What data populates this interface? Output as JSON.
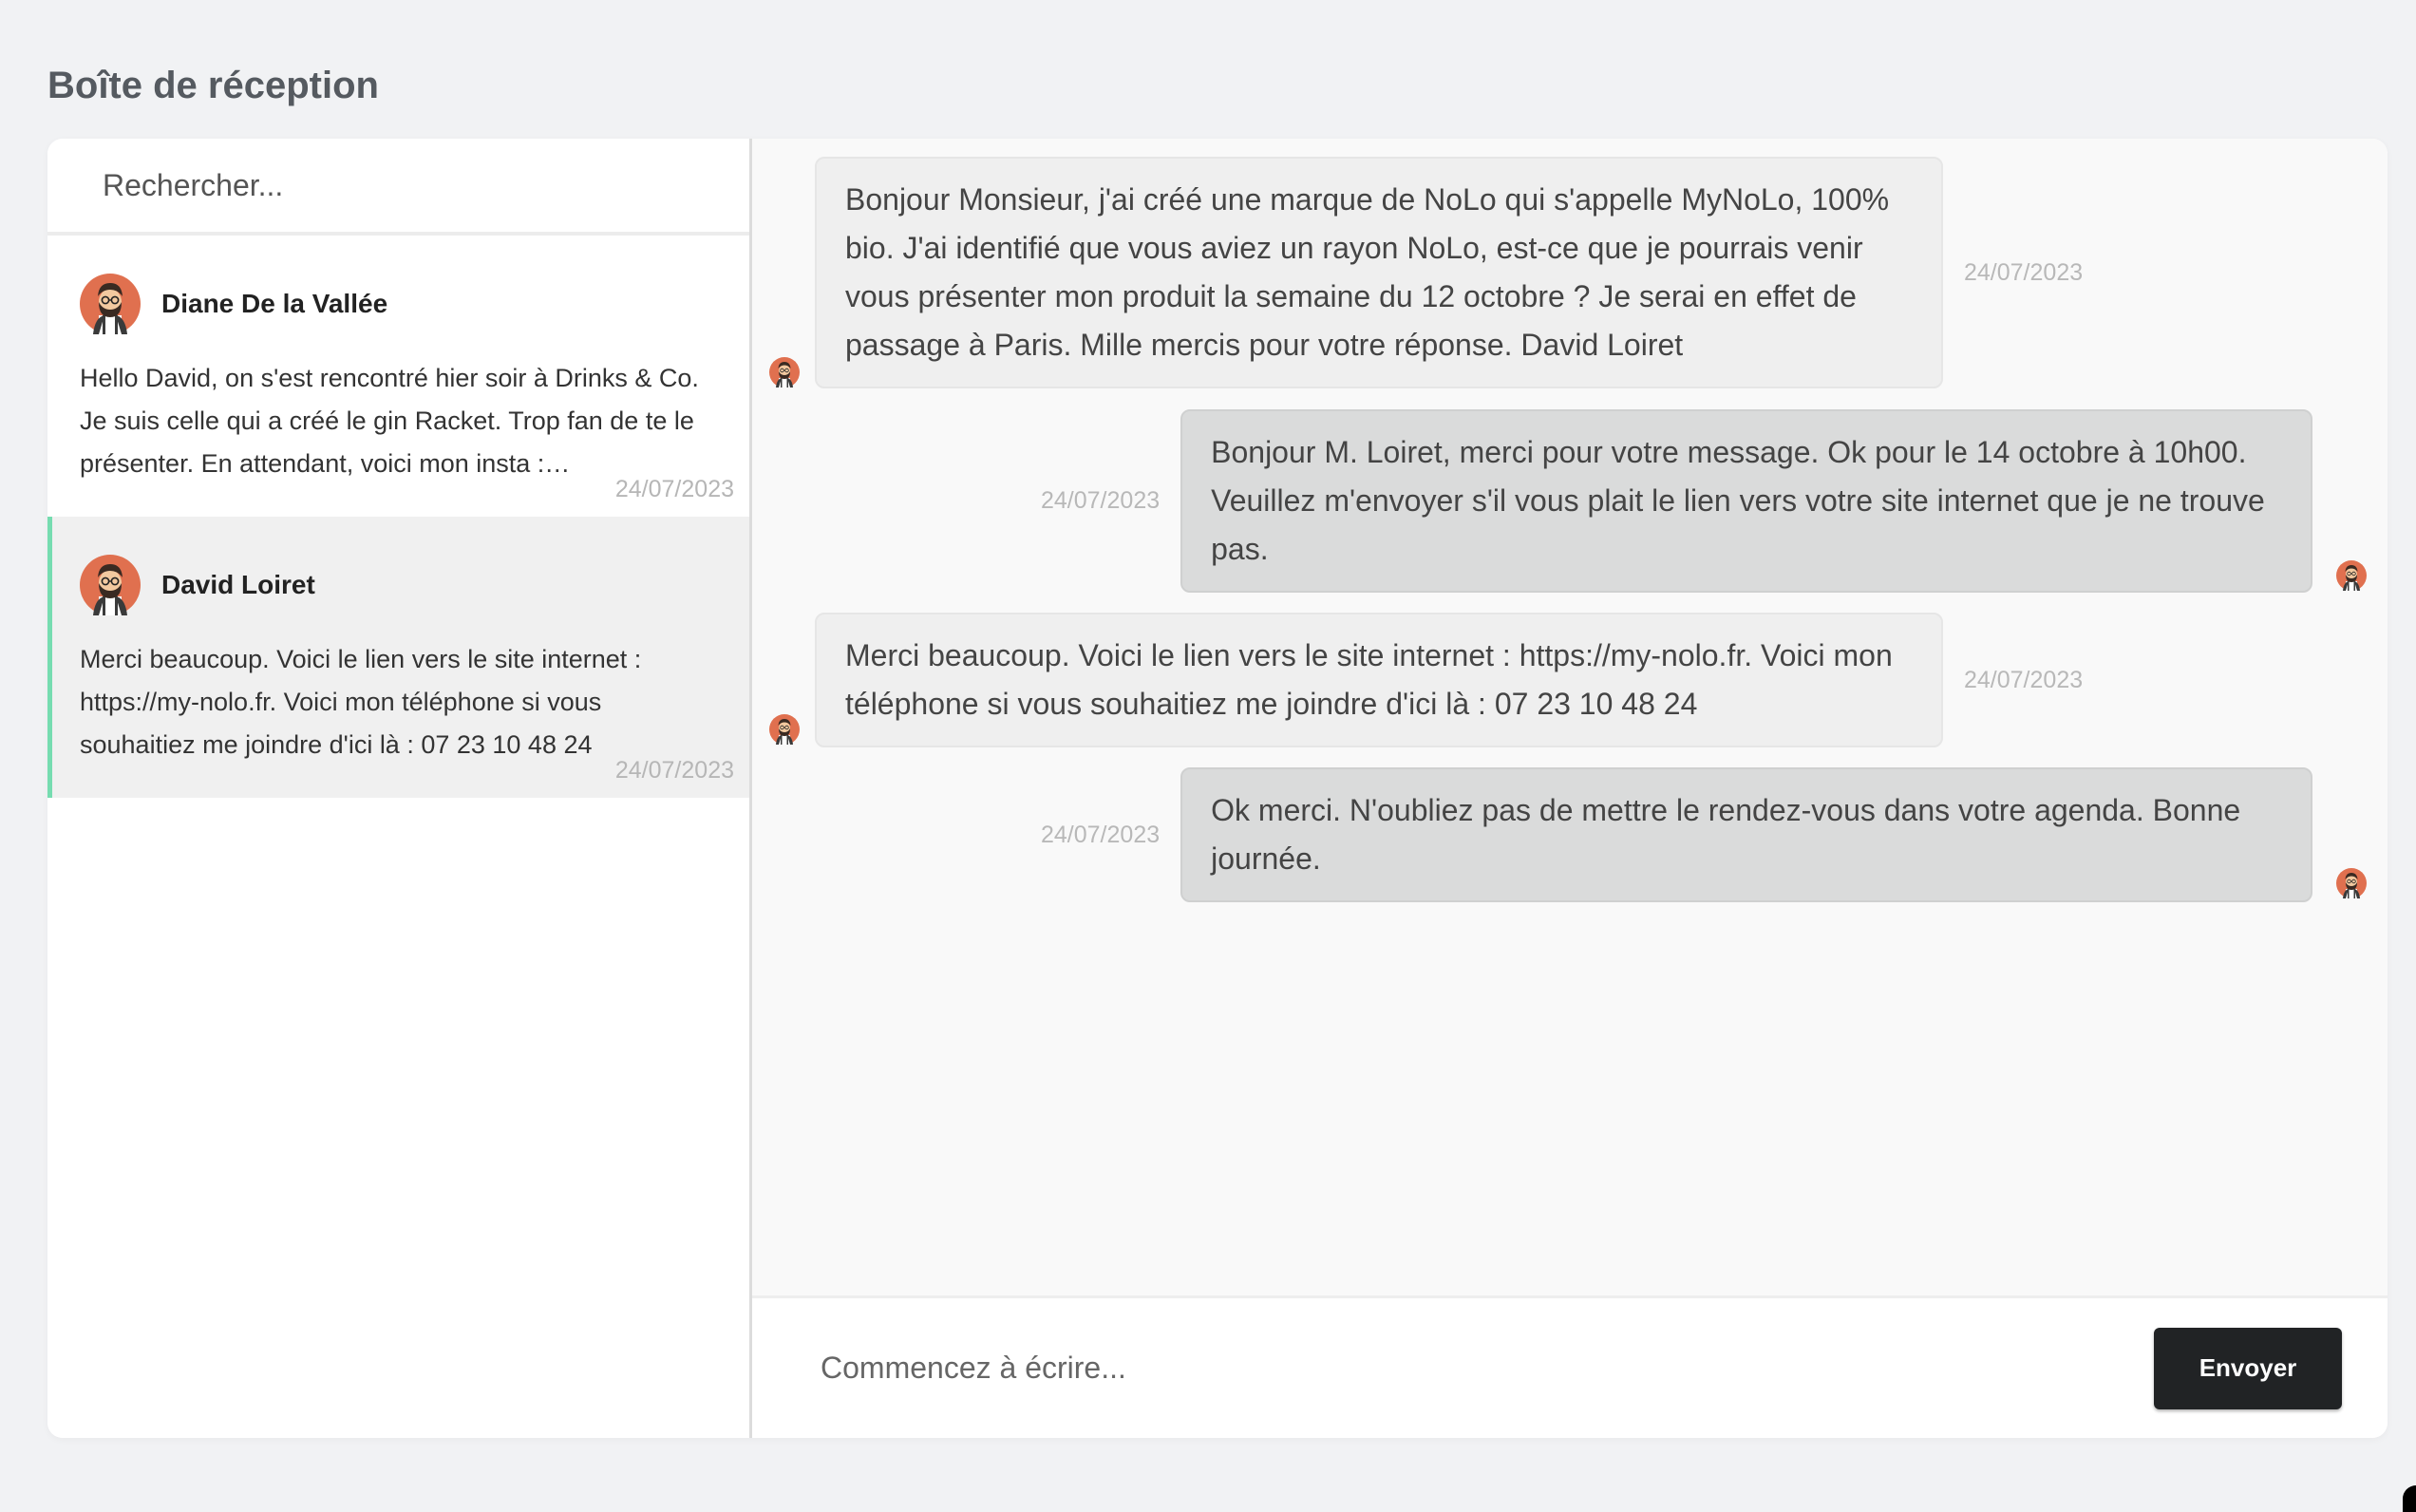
{
  "page": {
    "title": "Boîte de réception"
  },
  "search": {
    "placeholder": "Rechercher..."
  },
  "conversations": [
    {
      "name": "Diane De la Vallée",
      "preview": "Hello David, on s'est rencontré hier soir à Drinks & Co. Je suis celle qui a créé le gin Racket. Trop fan de te le présenter. En attendant, voici mon insta : @ginracket_officiel",
      "date": "24/07/2023",
      "active": false
    },
    {
      "name": "David Loiret",
      "preview": "Merci beaucoup. Voici le lien vers le site internet : https://my-nolo.fr. Voici mon téléphone si vous souhaitiez me joindre d'ici là : 07 23 10 48 24",
      "date": "24/07/2023",
      "active": true
    }
  ],
  "messages": [
    {
      "direction": "incoming",
      "text": "Bonjour Monsieur, j'ai créé une marque de NoLo qui s'appelle MyNoLo, 100% bio. J'ai identifié que vous aviez un rayon NoLo, est-ce que je pourrais venir vous présenter mon produit la semaine du 12 octobre ? Je serai en effet de passage à Paris. Mille mercis pour votre réponse. David Loiret",
      "date": "24/07/2023"
    },
    {
      "direction": "outgoing",
      "text": "Bonjour M. Loiret, merci pour votre message. Ok pour le 14 octobre à 10h00. Veuillez m'envoyer s'il vous plait le lien vers votre site internet que je ne trouve pas.",
      "date": "24/07/2023"
    },
    {
      "direction": "incoming",
      "text": "Merci beaucoup. Voici le lien vers le site internet : https://my-nolo.fr. Voici mon téléphone si vous souhaitiez me joindre d'ici là : 07 23 10 48 24",
      "date": "24/07/2023"
    },
    {
      "direction": "outgoing",
      "text": "Ok merci. N'oubliez pas de mettre le rendez-vous dans votre agenda. Bonne journée.",
      "date": "24/07/2023"
    }
  ],
  "composer": {
    "placeholder": "Commencez à écrire...",
    "send_label": "Envoyer"
  },
  "colors": {
    "accent": "#76dcb0",
    "send_button": "#212325",
    "avatar": "#e0704f"
  },
  "icons": {
    "avatar": "avatar-icon"
  }
}
